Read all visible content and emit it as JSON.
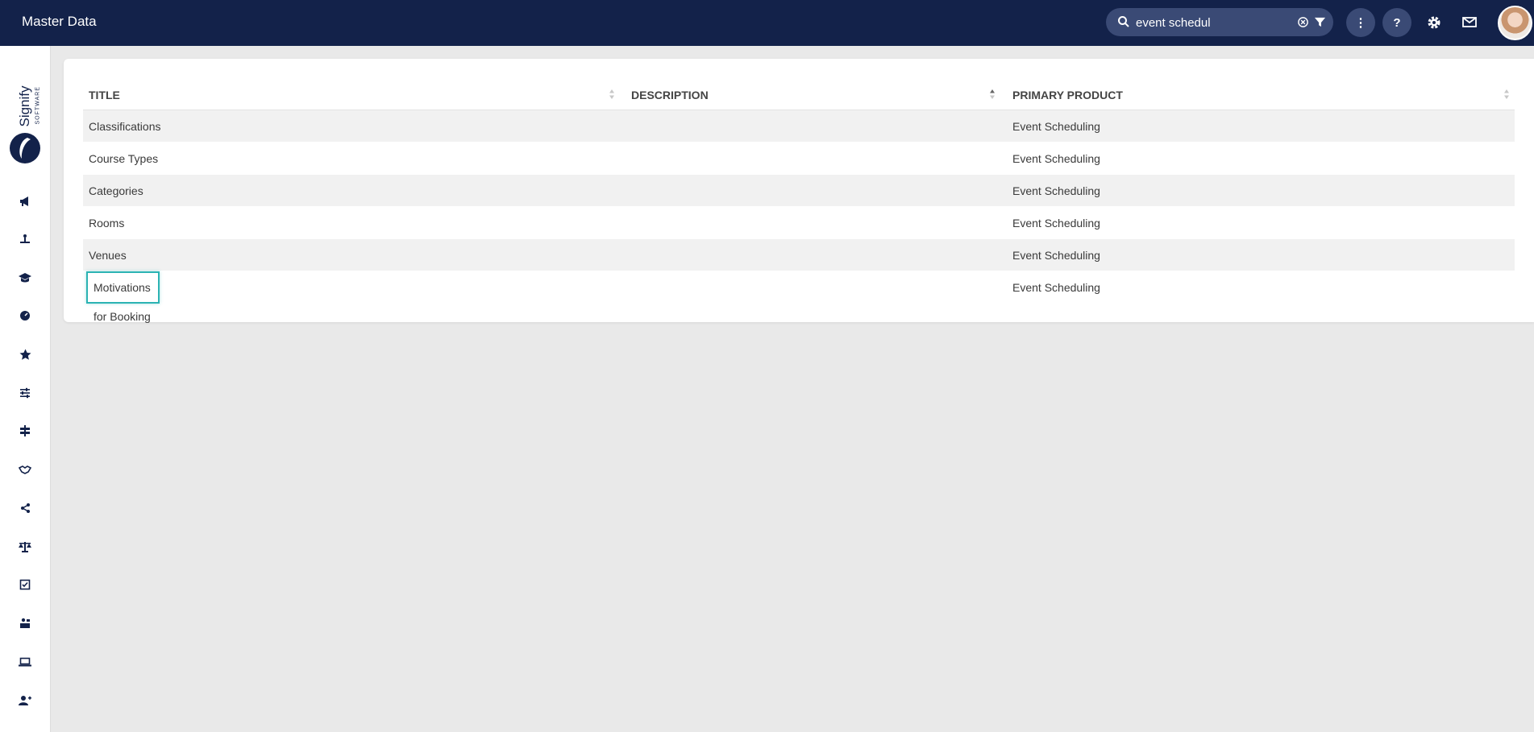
{
  "header": {
    "title": "Master Data",
    "search": {
      "value": "event schedul",
      "icon": "search-icon",
      "clear_icon": "clear-circle-icon",
      "filter_icon": "filter-icon"
    },
    "more_label": "⋮",
    "help_label": "?",
    "settings_icon": "gear-icon",
    "messages_icon": "mail-icon"
  },
  "sidebar": {
    "logo_text": "Signify",
    "logo_sub": "SOFTWARE",
    "items": [
      {
        "icon": "megaphone-icon"
      },
      {
        "icon": "presenter-icon"
      },
      {
        "icon": "graduation-cap-icon"
      },
      {
        "icon": "gauge-icon"
      },
      {
        "icon": "star-icon"
      },
      {
        "icon": "sliders-icon"
      },
      {
        "icon": "signpost-icon"
      },
      {
        "icon": "handshake-icon"
      },
      {
        "icon": "network-icon"
      },
      {
        "icon": "balance-scale-icon"
      },
      {
        "icon": "checklist-icon"
      },
      {
        "icon": "person-desk-icon"
      },
      {
        "icon": "laptop-icon"
      },
      {
        "icon": "add-user-icon"
      }
    ]
  },
  "table": {
    "columns": [
      {
        "label": "TITLE"
      },
      {
        "label": "DESCRIPTION"
      },
      {
        "label": "PRIMARY PRODUCT"
      }
    ],
    "rows": [
      {
        "title": "Classifications",
        "description": "",
        "primary_product": "Event Scheduling"
      },
      {
        "title": "Course Types",
        "description": "",
        "primary_product": "Event Scheduling"
      },
      {
        "title": "Categories",
        "description": "",
        "primary_product": "Event Scheduling"
      },
      {
        "title": "Rooms",
        "description": "",
        "primary_product": "Event Scheduling"
      },
      {
        "title": "Venues",
        "description": "",
        "primary_product": "Event Scheduling"
      },
      {
        "title": "Motivations for Booking",
        "description": "",
        "primary_product": "Event Scheduling"
      }
    ],
    "focused_row": 5
  },
  "colors": {
    "topbar": "#13224a",
    "accent": "#2bb3b3"
  }
}
